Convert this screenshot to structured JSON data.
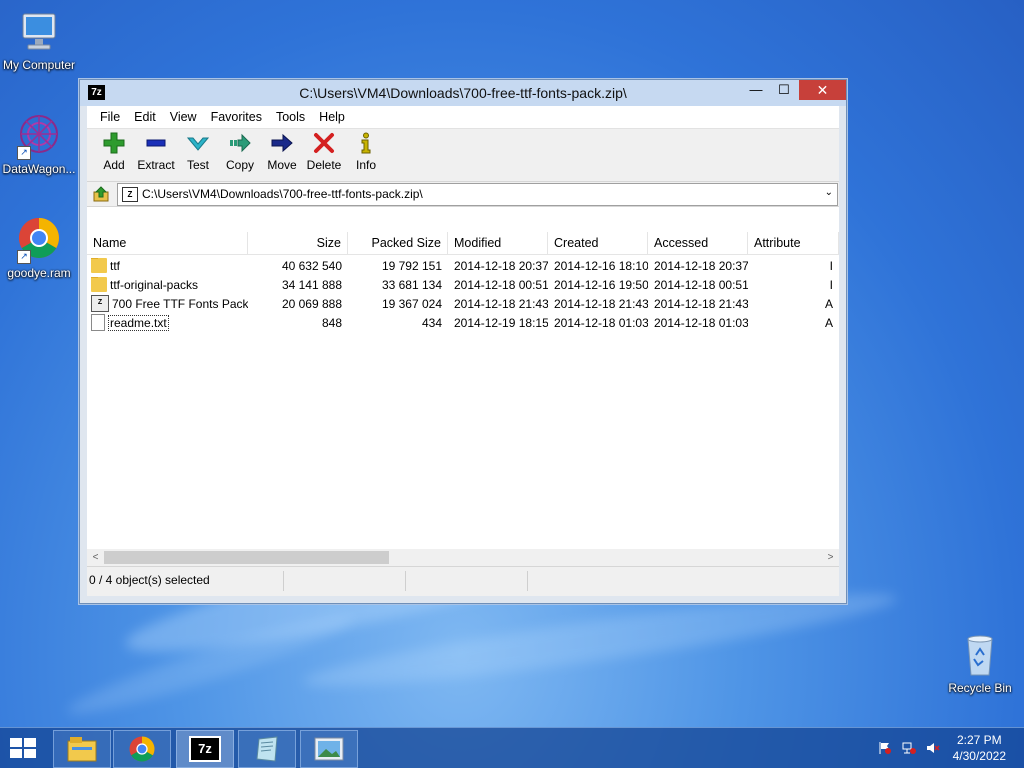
{
  "desktop": {
    "icons": [
      {
        "label": "My Computer"
      },
      {
        "label": "DataWagon..."
      },
      {
        "label": "goodye.ram"
      },
      {
        "label": "Recycle Bin"
      }
    ]
  },
  "window": {
    "title": "C:\\Users\\VM4\\Downloads\\700-free-ttf-fonts-pack.zip\\",
    "app_icon_text": "7z",
    "controls": {
      "minimize": "—",
      "maximize": "☐",
      "close": "✕"
    }
  },
  "menu": [
    "File",
    "Edit",
    "View",
    "Favorites",
    "Tools",
    "Help"
  ],
  "toolbar": [
    {
      "label": "Add",
      "icon": "add-icon",
      "color": "#2e9b2e"
    },
    {
      "label": "Extract",
      "icon": "extract-icon",
      "color": "#1a2fb8"
    },
    {
      "label": "Test",
      "icon": "test-icon",
      "color": "#2bb3c8"
    },
    {
      "label": "Copy",
      "icon": "copy-icon",
      "color": "#2a9b78"
    },
    {
      "label": "Move",
      "icon": "move-icon",
      "color": "#1a2a8a"
    },
    {
      "label": "Delete",
      "icon": "delete-icon",
      "color": "#d42020"
    },
    {
      "label": "Info",
      "icon": "info-icon",
      "color": "#c8b400"
    }
  ],
  "address": {
    "path": "C:\\Users\\VM4\\Downloads\\700-free-ttf-fonts-pack.zip\\",
    "dropdown": "⌄"
  },
  "columns": [
    "Name",
    "Size",
    "Packed Size",
    "Modified",
    "Created",
    "Accessed",
    "Attribute"
  ],
  "rows": [
    {
      "name": "ttf",
      "type": "folder",
      "size": "40 632 540",
      "packed": "19 792 151",
      "modified": "2014-12-18 20:37",
      "created": "2014-12-16 18:10",
      "accessed": "2014-12-18 20:37",
      "attr": "I"
    },
    {
      "name": "ttf-original-packs",
      "type": "folder",
      "size": "34 141 888",
      "packed": "33 681 134",
      "modified": "2014-12-18 00:51",
      "created": "2014-12-16 19:50",
      "accessed": "2014-12-18 00:51",
      "attr": "I"
    },
    {
      "name": "700 Free TTF Fonts Pack...",
      "type": "zip",
      "size": "20 069 888",
      "packed": "19 367 024",
      "modified": "2014-12-18 21:43",
      "created": "2014-12-18 21:43",
      "accessed": "2014-12-18 21:43",
      "attr": "A"
    },
    {
      "name": "readme.txt",
      "type": "txt",
      "size": "848",
      "packed": "434",
      "modified": "2014-12-19 18:15",
      "created": "2014-12-18 01:03",
      "accessed": "2014-12-18 01:03",
      "attr": "A"
    }
  ],
  "status": {
    "selection": "0 / 4 object(s) selected"
  },
  "taskbar": {
    "apps": [
      "file-explorer-icon",
      "chrome-icon",
      "7zip-icon",
      "notepad-icon",
      "image-viewer-icon"
    ],
    "time": "2:27 PM",
    "date": "4/30/2022"
  }
}
